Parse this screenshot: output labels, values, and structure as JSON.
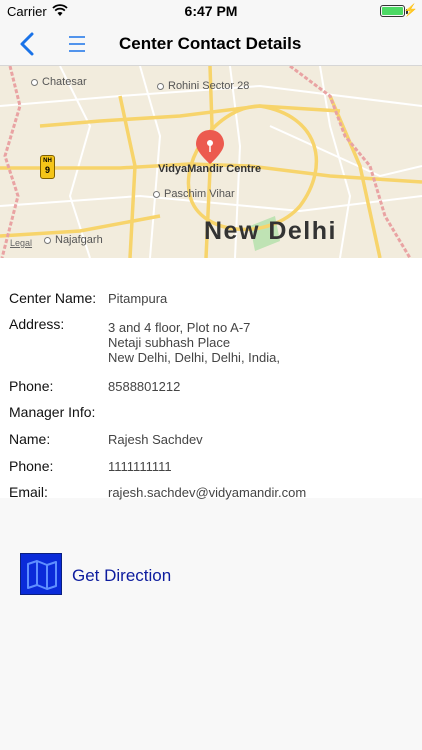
{
  "status_bar": {
    "carrier": "Carrier",
    "time": "6:47 PM"
  },
  "nav": {
    "title": "Center Contact Details",
    "back_icon": "chevron-left-icon",
    "menu_icon": "hamburger-menu-icon",
    "accent_color": "#1a73e8"
  },
  "map": {
    "labels": {
      "chatesar": "Chatesar",
      "rohini": "Rohini Sector 28",
      "pin": "VidyaMandir Centre",
      "paschim": "Paschim Vihar",
      "najafgarh": "Najafgarh",
      "city": "New Delhi",
      "legal": "Legal",
      "nh_top": "NH",
      "nh_num": "9"
    }
  },
  "details": {
    "center_name_label": "Center Name:",
    "center_name": "Pitampura",
    "address_label": "Address:",
    "address_line1": "3 and 4 floor, Plot no A-7",
    "address_line2": "Netaji subhash Place",
    "address_line3": "New Delhi, Delhi, Delhi, India,",
    "phone_label": "Phone:",
    "phone": "8588801212",
    "manager_label": "Manager Info:",
    "name_label": "Name:",
    "manager_name": "Rajesh Sachdev",
    "manager_phone_label": "Phone:",
    "manager_phone": "1111111111",
    "email_label": "Email:",
    "email": "rajesh.sachdev@vidyamandir.com"
  },
  "direction": {
    "label": "Get Direction",
    "icon": "map-icon"
  }
}
